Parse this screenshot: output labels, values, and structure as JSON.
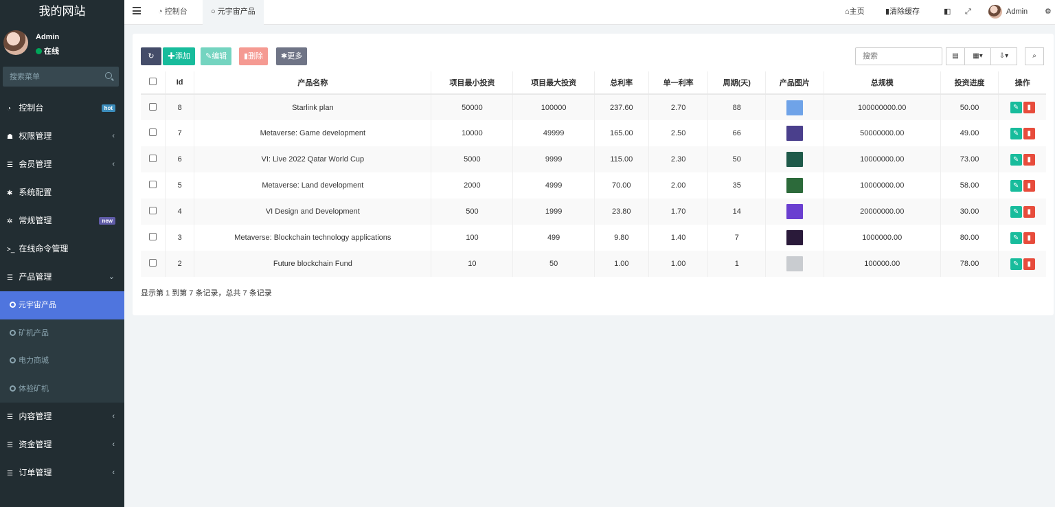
{
  "app": {
    "title": "我的网站"
  },
  "user": {
    "name": "Admin",
    "status": "在线"
  },
  "sidebar_search": {
    "placeholder": "搜索菜单"
  },
  "menu": [
    {
      "label": "控制台",
      "badge": "hot"
    },
    {
      "label": "权限管理"
    },
    {
      "label": "会员管理"
    },
    {
      "label": "系统配置"
    },
    {
      "label": "常规管理",
      "badge": "new"
    },
    {
      "label": "在线命令管理"
    },
    {
      "label": "产品管理"
    }
  ],
  "submenu": [
    {
      "label": "元宇宙产品",
      "active": true
    },
    {
      "label": "矿机产品"
    },
    {
      "label": "电力商城"
    },
    {
      "label": "体验矿机"
    }
  ],
  "menu_bottom": [
    {
      "label": "内容管理"
    },
    {
      "label": "资金管理"
    },
    {
      "label": "订单管理"
    }
  ],
  "topbar": {
    "tabs": [
      "控制台",
      "元宇宙产品"
    ],
    "home": "主页",
    "clear_cache": "清除缓存",
    "user": "Admin"
  },
  "toolbar": {
    "add": "添加",
    "edit": "编辑",
    "delete": "删除",
    "more": "更多",
    "search_placeholder": "搜索"
  },
  "table": {
    "headers": [
      "Id",
      "产品名称",
      "项目最小投资",
      "项目最大投资",
      "总利率",
      "单一利率",
      "周期(天)",
      "产品图片",
      "总规模",
      "投资进度",
      "操作"
    ],
    "rows": [
      {
        "id": "8",
        "name": "Starlink plan",
        "min": "50000",
        "max": "100000",
        "total_rate": "237.60",
        "rate": "2.70",
        "days": "88",
        "scale": "100000000.00",
        "progress": "50.00",
        "img_color": "#6fa3e8"
      },
      {
        "id": "7",
        "name": "Metaverse: Game development",
        "min": "10000",
        "max": "49999",
        "total_rate": "165.00",
        "rate": "2.50",
        "days": "66",
        "scale": "50000000.00",
        "progress": "49.00",
        "img_color": "#4a3f8c"
      },
      {
        "id": "6",
        "name": "VI: Live 2022 Qatar World Cup",
        "min": "5000",
        "max": "9999",
        "total_rate": "115.00",
        "rate": "2.30",
        "days": "50",
        "scale": "10000000.00",
        "progress": "73.00",
        "img_color": "#1f5a4a"
      },
      {
        "id": "5",
        "name": "Metaverse: Land development",
        "min": "2000",
        "max": "4999",
        "total_rate": "70.00",
        "rate": "2.00",
        "days": "35",
        "scale": "10000000.00",
        "progress": "58.00",
        "img_color": "#2c6a3a"
      },
      {
        "id": "4",
        "name": "VI Design and Development",
        "min": "500",
        "max": "1999",
        "total_rate": "23.80",
        "rate": "1.70",
        "days": "14",
        "scale": "20000000.00",
        "progress": "30.00",
        "img_color": "#6a3fd0"
      },
      {
        "id": "3",
        "name": "Metaverse: Blockchain technology applications",
        "min": "100",
        "max": "499",
        "total_rate": "9.80",
        "rate": "1.40",
        "days": "7",
        "scale": "1000000.00",
        "progress": "80.00",
        "img_color": "#2a1a3a"
      },
      {
        "id": "2",
        "name": "Future blockchain Fund",
        "min": "10",
        "max": "50",
        "total_rate": "1.00",
        "rate": "1.00",
        "days": "1",
        "scale": "100000.00",
        "progress": "78.00",
        "img_color": "#c9ccd0"
      }
    ]
  },
  "footer": {
    "summary": "显示第 1 到第 7 条记录，总共 7 条记录"
  }
}
